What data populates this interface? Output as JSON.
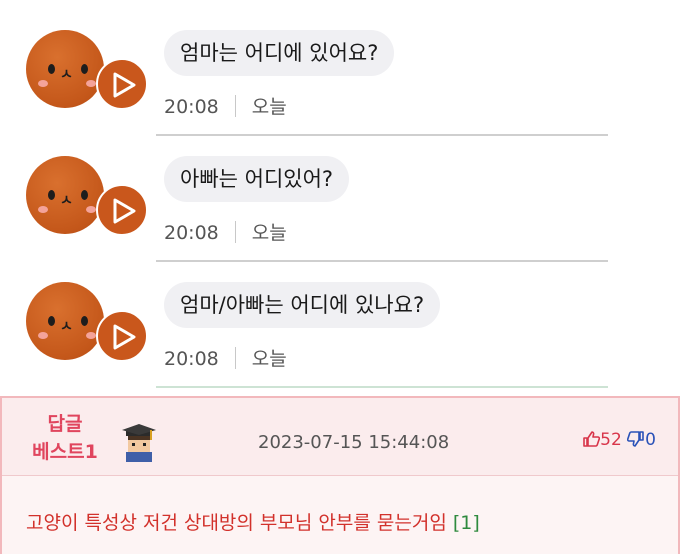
{
  "messages": [
    {
      "text": "엄마는 어디에 있어요?",
      "time": "20:08",
      "day": "오늘"
    },
    {
      "text": "아빠는 어디있어?",
      "time": "20:08",
      "day": "오늘"
    },
    {
      "text": "엄마/아빠는 어디에 있나요?",
      "time": "20:08",
      "day": "오늘"
    }
  ],
  "reply": {
    "badge_line1": "답글",
    "badge_line2": "베스트1",
    "date": "2023-07-15 15:44:08",
    "upvotes": "52",
    "downvotes": "0",
    "body": "고양이 특성상 저건 상대방의 부모님 안부를 묻는거임",
    "reply_count": "[1]"
  },
  "colors": {
    "accent": "#e0455e",
    "avatar": "#c4571a",
    "body_text": "#d2312b"
  },
  "icons": [
    "cat-avatar-icon",
    "play-icon",
    "thumbs-up-icon",
    "thumbs-down-icon",
    "user-icon"
  ]
}
